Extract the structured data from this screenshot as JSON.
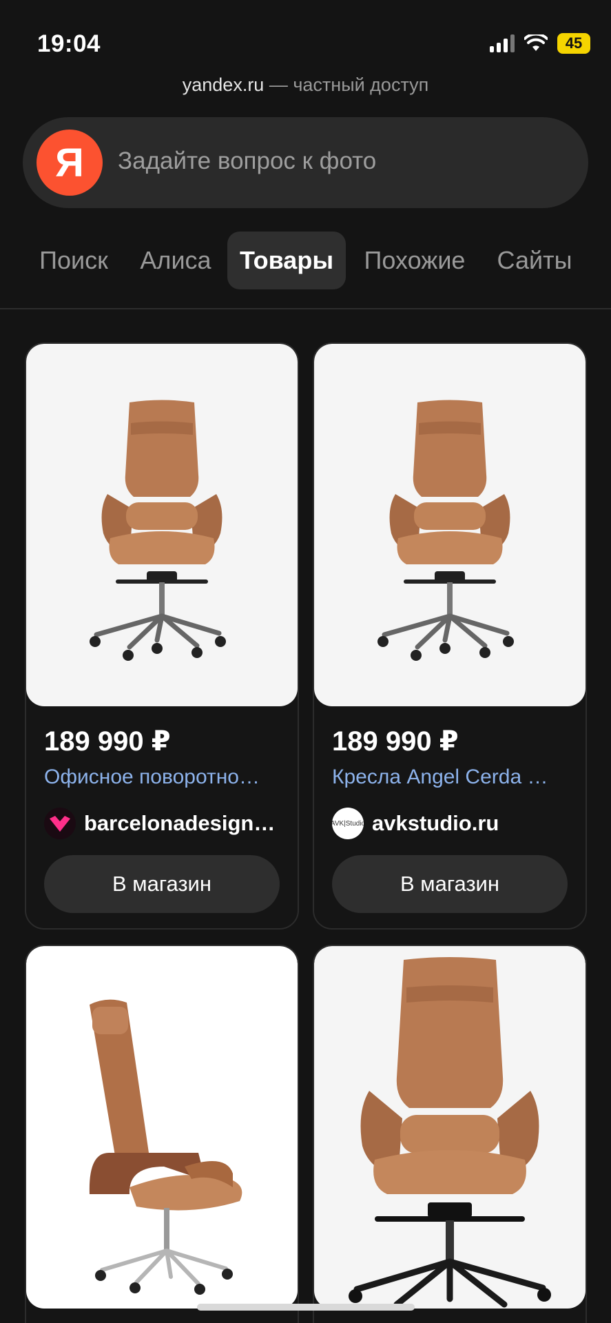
{
  "status": {
    "time": "19:04",
    "battery": "45"
  },
  "url": {
    "domain": "yandex.ru",
    "access": " — частный доступ"
  },
  "search": {
    "logo": "Я",
    "placeholder": "Задайте вопрос к фото"
  },
  "tabs": [
    {
      "label": "Поиск",
      "active": false
    },
    {
      "label": "Алиса",
      "active": false
    },
    {
      "label": "Товары",
      "active": true
    },
    {
      "label": "Похожие",
      "active": false
    },
    {
      "label": "Сайты",
      "active": false
    }
  ],
  "products": [
    {
      "price": "189 990 ₽",
      "title": "Офисное поворотно…",
      "shop": "barcelonadesign…",
      "shop_logo_text": "",
      "button": "В магазин",
      "image": "office-chair-brown-icon"
    },
    {
      "price": "189 990 ₽",
      "title": "Кресла Angel Cerda …",
      "shop": "avkstudio.ru",
      "shop_logo_text": "AVK|Studio",
      "button": "В магазин",
      "image": "office-chair-brown-icon"
    },
    {
      "image": "office-chair-side-brown-icon"
    },
    {
      "image": "office-chair-brown-icon"
    }
  ],
  "colors": {
    "accent": "#fc5230",
    "link": "#8db3ec",
    "battery": "#f5d400",
    "background": "#141414"
  }
}
